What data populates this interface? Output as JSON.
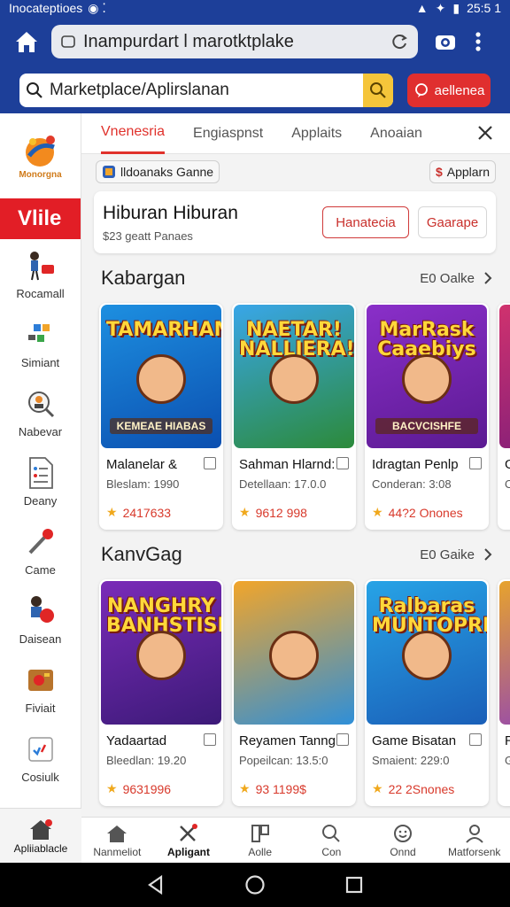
{
  "status_bar": {
    "left_text": "Inocateptioes",
    "time": "25:5 1"
  },
  "browser": {
    "url": "Inampurdart l marotktplake"
  },
  "search": {
    "placeholder": "Marketplace/Aplirslanan",
    "account_label": "aellenea"
  },
  "sidebar": {
    "logo_text": "Monorgna",
    "active_label": "Vlile",
    "items": [
      {
        "label": "Rocamall",
        "icon": "person-cart-icon"
      },
      {
        "label": "Simiant",
        "icon": "blocks-icon"
      },
      {
        "label": "Nabevar",
        "icon": "magnifier-person-icon"
      },
      {
        "label": "Deany",
        "icon": "document-icon"
      },
      {
        "label": "Came",
        "icon": "microphone-icon"
      },
      {
        "label": "Daisean",
        "icon": "person-ball-icon"
      },
      {
        "label": "Fiviait",
        "icon": "tools-icon"
      },
      {
        "label": "Cosiulk",
        "icon": "checklist-icon"
      }
    ],
    "bottom_label": "Apliiablacle"
  },
  "tabs": [
    {
      "label": "Vnenesria",
      "active": true
    },
    {
      "label": "Engiaspnst",
      "active": false
    },
    {
      "label": "Applaits",
      "active": false
    },
    {
      "label": "Anoaian",
      "active": false
    }
  ],
  "chips": {
    "left": "lldoanaks Ganne",
    "right": "Applarn"
  },
  "hero": {
    "title": "Hiburan Hiburan",
    "subtitle": "$23 geatt Panaes",
    "primary_button": "Hanatecia",
    "secondary_button": "Gaarape"
  },
  "sections": [
    {
      "title": "Kabargan",
      "link": "E0 Oalke",
      "cards": [
        {
          "name": "Malanelar &",
          "meta": "Bleslam: 1990",
          "rating": "2417633",
          "thumb_title": "TAMARHAM!",
          "thumb_sub": "KEMEAE HIABAS",
          "colors": [
            "#1d8fe0",
            "#0b4fb0"
          ]
        },
        {
          "name": "Sahman Hlarnd:",
          "meta": "Detellaan: 17.0.0",
          "rating": "9612 998",
          "thumb_title": "NAETAR! NALLIERA!",
          "thumb_sub": "",
          "colors": [
            "#39a6e8",
            "#2c8a3a"
          ]
        },
        {
          "name": "Idragtan Penlp",
          "meta": "Conderan: 3:08",
          "rating": "44?2 Onones",
          "thumb_title": "MarRask Caaebiys",
          "thumb_sub": "BACVCISHFE",
          "colors": [
            "#8a2fc9",
            "#5b1a92"
          ]
        },
        {
          "name": "Ga",
          "meta": "Or",
          "rating": "",
          "thumb_title": "",
          "thumb_sub": "",
          "colors": [
            "#d0326e",
            "#7b1d7a"
          ]
        }
      ]
    },
    {
      "title": "KanvGag",
      "link": "E0 Gaike",
      "cards": [
        {
          "name": "Yadaartad",
          "meta": "Bleedlan: 19.20",
          "rating": "9631996",
          "thumb_title": "NANGHRY BANHSTISE",
          "thumb_sub": "",
          "colors": [
            "#7a2bb8",
            "#3c1a78"
          ]
        },
        {
          "name": "Reyamen Tanng",
          "meta": "Popeilcan: 13.5:0",
          "rating": "93 1199$",
          "thumb_title": "",
          "thumb_sub": "",
          "colors": [
            "#f2a52a",
            "#2f8fd8"
          ]
        },
        {
          "name": "Game Bisatan",
          "meta": "Smaient: 229:0",
          "rating": "22 2Snones",
          "thumb_title": "Ralbaras MUNTOPRHS",
          "thumb_sub": "",
          "colors": [
            "#27a3e6",
            "#1a5fb8"
          ]
        },
        {
          "name": "Re",
          "meta": "Gc",
          "rating": "",
          "thumb_title": "",
          "thumb_sub": "",
          "colors": [
            "#e7a32d",
            "#8a3cc0"
          ]
        }
      ]
    }
  ],
  "bottom_nav": [
    {
      "label": "Nanmeliot",
      "icon": "home-icon",
      "active": false
    },
    {
      "label": "Apligant",
      "icon": "tools-icon",
      "active": true
    },
    {
      "label": "Aolle",
      "icon": "grid-icon",
      "active": false
    },
    {
      "label": "Con",
      "icon": "search-icon",
      "active": false
    },
    {
      "label": "Onnd",
      "icon": "smile-icon",
      "active": false
    },
    {
      "label": "Matforsenk",
      "icon": "person-icon",
      "active": false
    }
  ],
  "colors": {
    "brand_blue": "#1d3f99",
    "accent_red": "#e21e26",
    "rating_red": "#d8392b",
    "star": "#f0a81c"
  }
}
